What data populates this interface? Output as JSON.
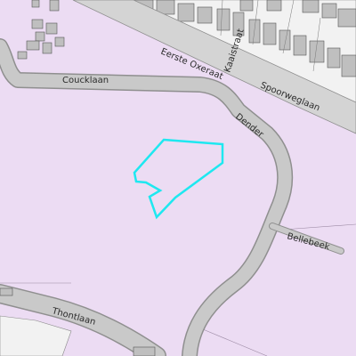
{
  "map": {
    "streets": {
      "coucklaan": "Coucklaan",
      "kaaistraat": "Kaaistraat",
      "spoorweglaan": "Spoorweglaan",
      "eerste_oxeraat": "Eerste Oxeraat",
      "thontlaan": "Thontlaan"
    },
    "waterways": {
      "dender": "Dender",
      "bellebeek": "Bellebeek"
    },
    "colors": {
      "land_use": "#ecdcf3",
      "road_fill": "#c9c9c9",
      "road_edge": "#8f8f8f",
      "building_fill": "#bfbfbf",
      "building_edge": "#555555",
      "highlight_parcel": "#1ee8f0"
    }
  }
}
